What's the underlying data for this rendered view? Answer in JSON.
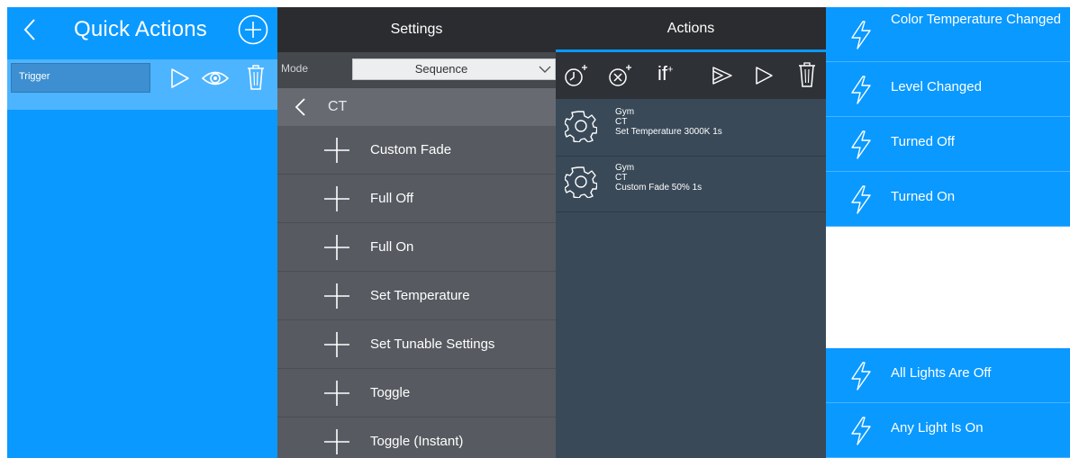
{
  "quick_actions": {
    "title": "Quick Actions",
    "trigger_label": "Trigger",
    "icons": [
      "back-icon",
      "add-circle-icon",
      "play-icon",
      "eye-icon",
      "trash-icon"
    ]
  },
  "settings": {
    "header": "Settings",
    "mode_label": "Mode",
    "mode_value": "Sequence",
    "category": "CT",
    "items": [
      "Custom Fade",
      "Full Off",
      "Full On",
      "Set Temperature",
      "Set Tunable Settings",
      "Toggle",
      "Toggle (Instant)"
    ]
  },
  "actions": {
    "header": "Actions",
    "toolbar": {
      "if_label": "if",
      "if_sup": "+",
      "icons": [
        "clock-add-icon",
        "timer-add-icon",
        "if-add-icon",
        "play-all-icon",
        "play-icon",
        "trash-icon"
      ]
    },
    "items": [
      {
        "line1": "Gym",
        "line2": "CT",
        "line3": "Set Temperature 3000K 1s"
      },
      {
        "line1": "Gym",
        "line2": "CT",
        "line3": "Custom Fade 50% 1s"
      }
    ]
  },
  "triggers": {
    "top": [
      "Color Temperature Changed",
      "Level Changed",
      "Turned Off",
      "Turned On"
    ],
    "bottom": [
      "All Lights Are Off",
      "Any Light Is On"
    ]
  },
  "colors": {
    "accent_blue": "#0a99ff",
    "dark_header": "#2b2c2f",
    "settings_bg": "#575b61",
    "actions_bg": "#394958"
  }
}
